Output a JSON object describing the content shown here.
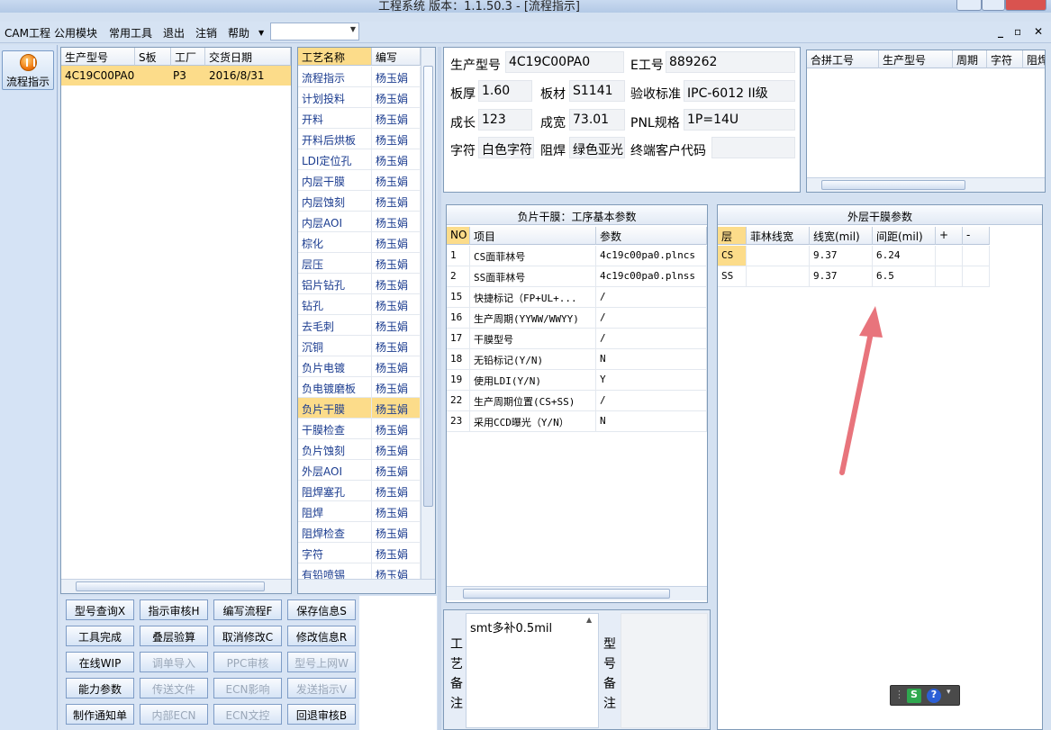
{
  "window": {
    "title": "工程系统    版本：1.1.50.3 - [流程指示]"
  },
  "menu": {
    "items": [
      "CAM工程",
      "公用模块",
      "常用工具",
      "退出",
      "注销",
      "帮助"
    ],
    "combo_value": ""
  },
  "left_nav": {
    "button_label": "流程指示"
  },
  "orders": {
    "headers": [
      "生产型号",
      "S板",
      "工厂",
      "交货日期"
    ],
    "rows": [
      [
        "4C19C00PA0",
        "",
        "P3",
        "2016/8/31"
      ]
    ]
  },
  "process": {
    "headers": [
      "工艺名称",
      "编写"
    ],
    "selected": "负片干膜",
    "rows": [
      [
        "流程指示",
        "杨玉娟"
      ],
      [
        "计划投料",
        "杨玉娟"
      ],
      [
        "开料",
        "杨玉娟"
      ],
      [
        "开料后烘板",
        "杨玉娟"
      ],
      [
        "LDI定位孔",
        "杨玉娟"
      ],
      [
        "内层干膜",
        "杨玉娟"
      ],
      [
        "内层蚀刻",
        "杨玉娟"
      ],
      [
        "内层AOI",
        "杨玉娟"
      ],
      [
        "棕化",
        "杨玉娟"
      ],
      [
        "层压",
        "杨玉娟"
      ],
      [
        "铝片钻孔",
        "杨玉娟"
      ],
      [
        "钻孔",
        "杨玉娟"
      ],
      [
        "去毛刺",
        "杨玉娟"
      ],
      [
        "沉铜",
        "杨玉娟"
      ],
      [
        "负片电镀",
        "杨玉娟"
      ],
      [
        "负电镀磨板",
        "杨玉娟"
      ],
      [
        "负片干膜",
        "杨玉娟"
      ],
      [
        "干膜检查",
        "杨玉娟"
      ],
      [
        "负片蚀刻",
        "杨玉娟"
      ],
      [
        "外层AOI",
        "杨玉娟"
      ],
      [
        "阻焊塞孔",
        "杨玉娟"
      ],
      [
        "阻焊",
        "杨玉娟"
      ],
      [
        "阻焊检查",
        "杨玉娟"
      ],
      [
        "字符",
        "杨玉娟"
      ],
      [
        "有铅喷锡",
        "杨玉娟"
      ]
    ]
  },
  "buttons": [
    {
      "label": "型号查询X",
      "enabled": true
    },
    {
      "label": "指示审核H",
      "enabled": true
    },
    {
      "label": "编写流程F",
      "enabled": true
    },
    {
      "label": "保存信息S",
      "enabled": true
    },
    {
      "label": "工具完成",
      "enabled": true
    },
    {
      "label": "叠层验算",
      "enabled": true
    },
    {
      "label": "取消修改C",
      "enabled": true
    },
    {
      "label": "修改信息R",
      "enabled": true
    },
    {
      "label": "在线WIP",
      "enabled": true
    },
    {
      "label": "调单导入",
      "enabled": false
    },
    {
      "label": "PPC审核",
      "enabled": false
    },
    {
      "label": "型号上网W",
      "enabled": false
    },
    {
      "label": "能力参数",
      "enabled": true
    },
    {
      "label": "传送文件",
      "enabled": false
    },
    {
      "label": "ECN影响",
      "enabled": false
    },
    {
      "label": "发送指示V",
      "enabled": false
    },
    {
      "label": "制作通知单",
      "enabled": true
    },
    {
      "label": "内部ECN",
      "enabled": false
    },
    {
      "label": "ECN文控",
      "enabled": false
    },
    {
      "label": "回退审核B",
      "enabled": true
    }
  ],
  "info": {
    "model_label": "生产型号",
    "model_value": "4C19C00PA0",
    "e_label": "E工号",
    "e_value": "889262",
    "thickness_label": "板厚",
    "thickness_value": "1.60",
    "material_label": "板材",
    "material_value": "S1141",
    "standard_label": "验收标准",
    "standard_value": "IPC-6012 II级",
    "length_label": "成长",
    "length_value": "123",
    "width_label": "成宽",
    "width_value": "73.01",
    "pnl_label": "PNL规格",
    "pnl_value": "1P=14U",
    "char_label": "字符",
    "char_value": "白色字符",
    "mask_label": "阻焊",
    "mask_value": "绿色亚光",
    "customer_label": "终端客户代码",
    "customer_value": ""
  },
  "combine": {
    "headers": [
      "合拼工号",
      "生产型号",
      "周期",
      "字符",
      "阻焊"
    ]
  },
  "params": {
    "title": "负片干膜：工序基本参数",
    "headers": [
      "NO",
      "项目",
      "参数"
    ],
    "rows": [
      [
        "1",
        "CS面菲林号",
        "4c19c00pa0.plncs"
      ],
      [
        "2",
        "SS面菲林号",
        "4c19c00pa0.plnss"
      ],
      [
        "15",
        "快捷标记（FP+UL+...",
        "/"
      ],
      [
        "16",
        "生产周期(YYWW/WWYY)",
        "/"
      ],
      [
        "17",
        "干膜型号",
        "/"
      ],
      [
        "18",
        "无铅标记(Y/N)",
        "N"
      ],
      [
        "19",
        "使用LDI(Y/N)",
        "Y"
      ],
      [
        "22",
        "生产周期位置(CS+SS)",
        "/"
      ],
      [
        "23",
        "采用CCD曝光（Y/N）",
        "N"
      ]
    ]
  },
  "outer": {
    "title": "外层干膜参数",
    "headers": [
      "层",
      "菲林线宽",
      "线宽(mil)",
      "间距(mil)",
      "+",
      "-"
    ],
    "rows": [
      [
        "CS",
        "",
        "9.37",
        "6.24"
      ],
      [
        "SS",
        "",
        "9.37",
        "6.5"
      ]
    ]
  },
  "remarks": {
    "process_label": "工艺备注",
    "process_text": "smt多补0.5mil",
    "model_label": "型号备注"
  },
  "colors": {
    "accent_arrow": "#e8747c",
    "selected_row": "#fcdc8a"
  }
}
